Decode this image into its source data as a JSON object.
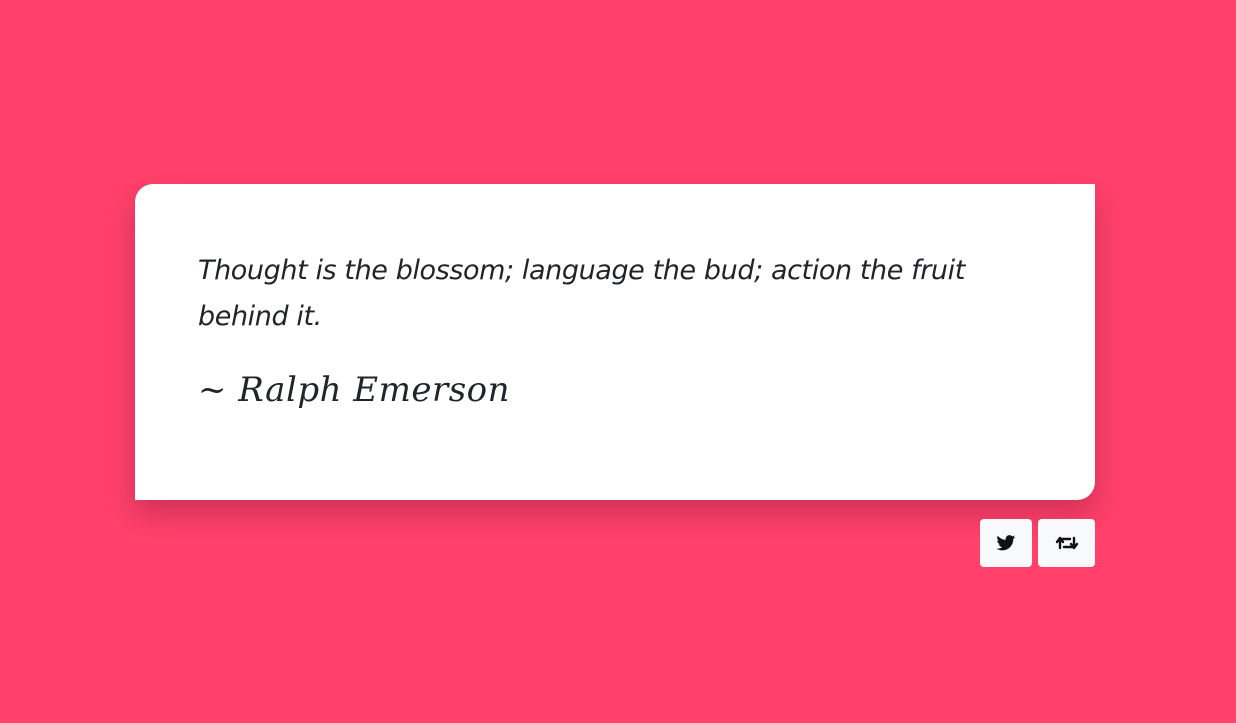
{
  "quote": {
    "text": "Thought is the blossom; language the bud; action the fruit behind it.",
    "author": "~ Ralph Emerson"
  },
  "actions": {
    "tweet_icon": "twitter-icon",
    "new_quote_icon": "retweet-icon"
  },
  "colors": {
    "background": "#ff416b",
    "card": "#ffffff",
    "text": "#212529",
    "button": "#f8f9fa"
  }
}
